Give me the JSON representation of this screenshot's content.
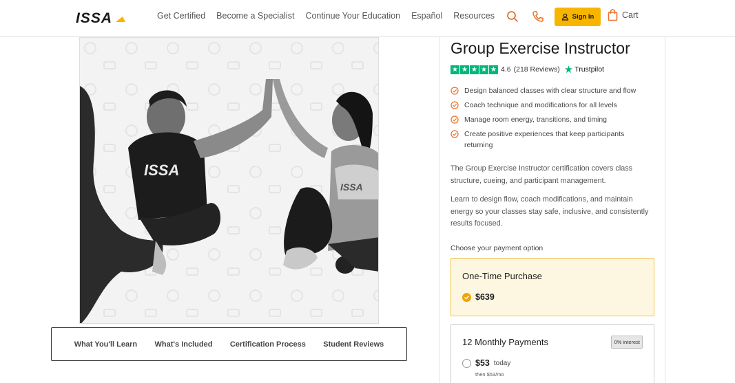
{
  "header": {
    "logo_text": "ISSA",
    "nav": [
      "Get Certified",
      "Become a Specialist",
      "Continue Your Education",
      "Español",
      "Resources"
    ],
    "search_icon": "search-icon",
    "phone_icon": "phone-icon",
    "signin_label": "Sign In",
    "cart_label": "Cart",
    "accent_color": "#f7b500",
    "icon_color": "#e8712a"
  },
  "hero": {
    "shirt_text_left": "ISSA",
    "shirt_text_right": "ISSA"
  },
  "tabs": [
    "What You'll Learn",
    "What's Included",
    "Certification Process",
    "Student Reviews"
  ],
  "product": {
    "title": "Group Exercise Instructor",
    "rating_value": "4.6",
    "rating_count": "(218 Reviews)",
    "rating_source": "Trustpilot",
    "rating_stars": 5,
    "bullets": [
      "Design balanced classes with clear structure and flow",
      "Coach technique and modifications for all levels",
      "Manage room energy, transitions, and timing",
      "Create positive experiences that keep participants returning"
    ],
    "description_1": "The Group Exercise Instructor certification covers class structure, cueing, and participant management.",
    "description_2": "Learn to design flow, coach modifications, and maintain energy so your classes stay safe, inclusive, and consistently results focused.",
    "choose_label": "Choose your payment option",
    "options": [
      {
        "name": "One-Time Purchase",
        "price": "$639",
        "selected": true
      },
      {
        "name": "12 Monthly Payments",
        "badge": "0% interest",
        "price": "$53",
        "price_suffix": "today",
        "note": "then $53/mo",
        "selected": false
      }
    ]
  }
}
